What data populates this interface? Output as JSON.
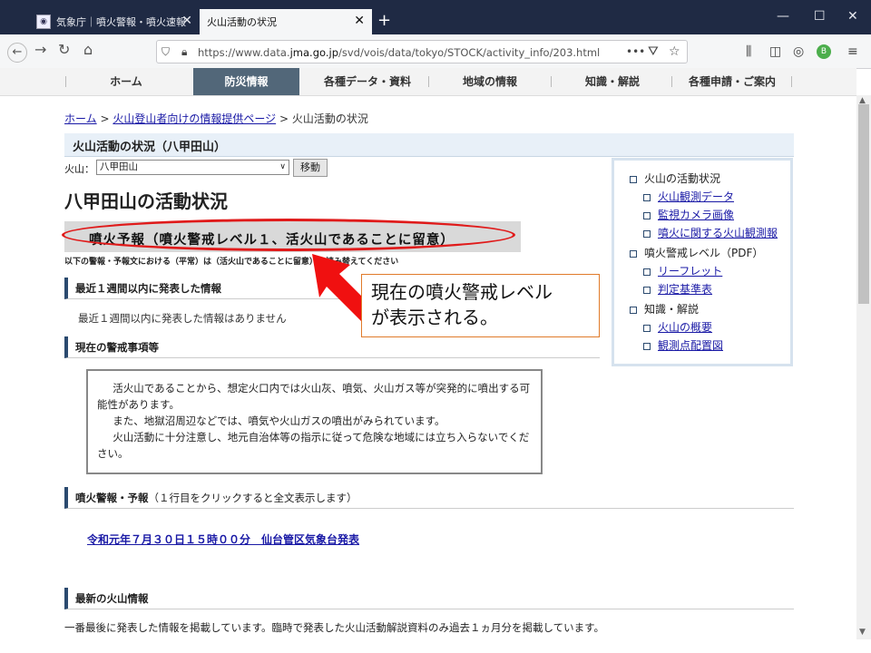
{
  "browser": {
    "tabs": [
      {
        "label": "気象庁｜噴火警報・噴火速報",
        "active": false
      },
      {
        "label": "火山活動の状況",
        "active": true
      }
    ],
    "url_prefix": "https://www.data.",
    "url_domain": "jma.go.jp",
    "url_path": "/svd/vois/data/tokyo/STOCK/activity_info/203.html",
    "url_dots": "•••",
    "profile_badge": "B"
  },
  "menu": {
    "items": [
      "ホーム",
      "防災情報",
      "各種データ・資料",
      "地域の情報",
      "知識・解説",
      "各種申請・ご案内"
    ],
    "active_index": 1
  },
  "breadcrumb": {
    "home": "ホーム",
    "sep": ">",
    "parent": "火山登山者向けの情報提供ページ",
    "current": "火山活動の状況"
  },
  "page_title": "火山活動の状況（八甲田山）",
  "volcano_selector": {
    "label": "火山：",
    "value": "八甲田山",
    "button": "移動"
  },
  "heading": "八甲田山の活動状況",
  "level": {
    "text": "噴火予報（噴火警戒レベル１、活火山であることに留意）",
    "note": "以下の警報・予報文における（平常）は（活火山であることに留意）に読み替えてください",
    "highlight_color": "#e01a1a"
  },
  "callout": {
    "line1": "現在の噴火警戒レベル",
    "line2": "が表示される。"
  },
  "sections": {
    "recent_title": "最近１週間以内に発表した情報",
    "recent_none": "最近１週間以内に発表した情報はありません",
    "warn_title": "現在の警戒事項等",
    "warn_paras": [
      "活火山であることから、想定火口内では火山灰、噴気、火山ガス等が突発的に噴出する可能性があります。",
      "また、地獄沼周辺などでは、噴気や火山ガスの噴出がみられています。",
      "火山活動に十分注意し、地元自治体等の指示に従って危険な地域には立ち入らないでください。"
    ],
    "bulletin_title": "噴火警報・予報",
    "bulletin_sub": "（１行目をクリックすると全文表示します）",
    "bulletin_link": "令和元年７月３０日１５時００分　仙台管区気象台発表",
    "latest_title": "最新の火山情報",
    "latest_note": "一番最後に発表した情報を掲載しています。臨時で発表した火山活動解説資料のみ過去１ヵ月分を掲載しています。"
  },
  "sidebar": {
    "groups": [
      {
        "title": "火山の活動状況",
        "links": [
          "火山観測データ",
          "監視カメラ画像",
          "噴火に関する火山観測報"
        ]
      },
      {
        "title": "噴火警戒レベル（PDF）",
        "links": [
          "リーフレット",
          "判定基準表"
        ]
      },
      {
        "title": "知識・解説",
        "links": [
          "火山の概要",
          "観測点配置図"
        ]
      }
    ]
  }
}
